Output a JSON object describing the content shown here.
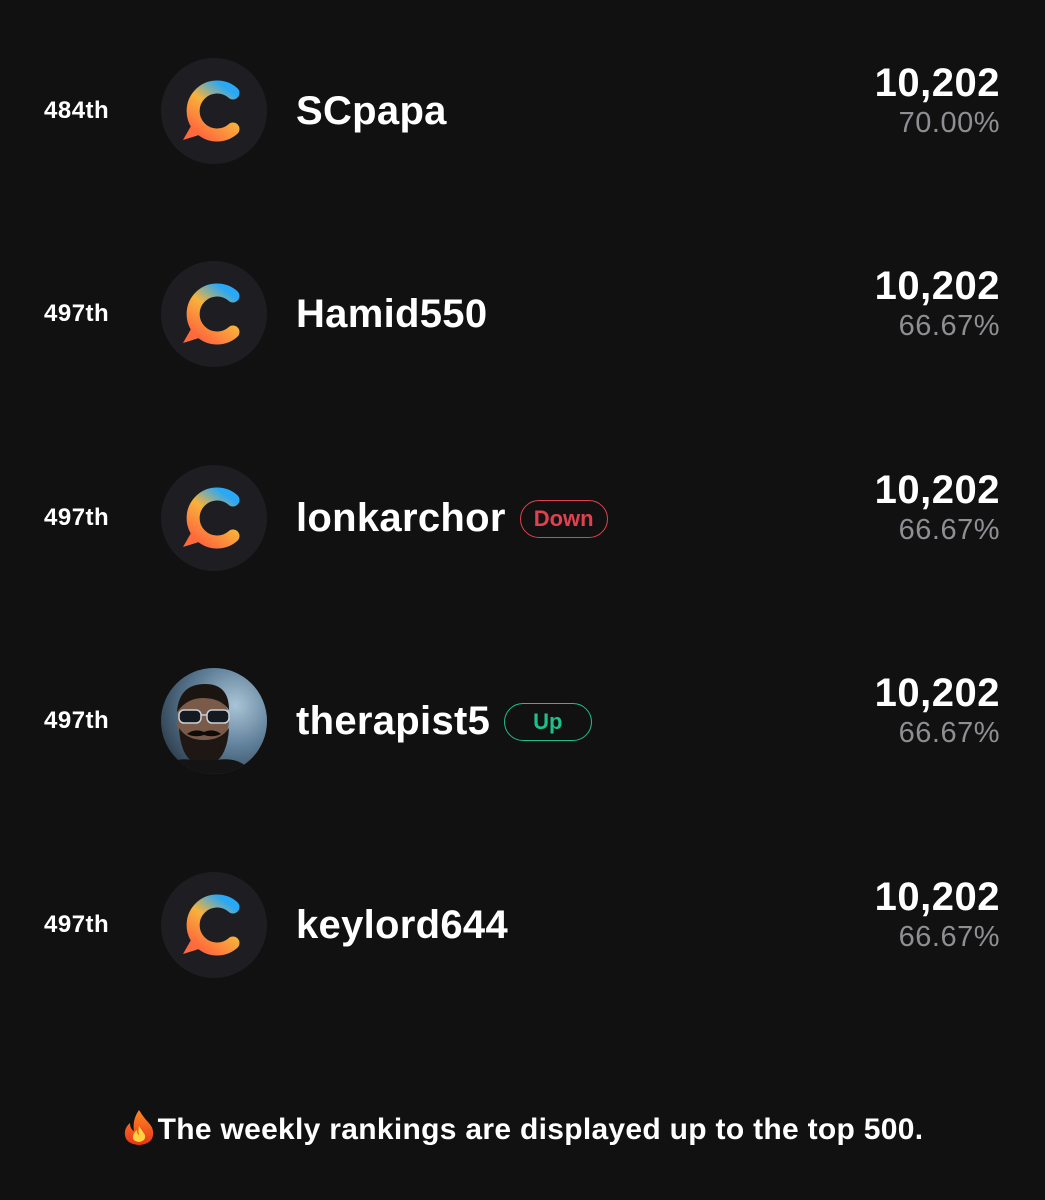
{
  "leaderboard": {
    "rows": [
      {
        "rank": "484th",
        "name": "SCpapa",
        "badge": "",
        "score": "10,202",
        "percent": "70.00%",
        "avatar": "brand-logo"
      },
      {
        "rank": "497th",
        "name": "Hamid550",
        "badge": "",
        "score": "10,202",
        "percent": "66.67%",
        "avatar": "brand-logo"
      },
      {
        "rank": "497th",
        "name": "lonkarchor",
        "badge": "Down",
        "score": "10,202",
        "percent": "66.67%",
        "avatar": "brand-logo"
      },
      {
        "rank": "497th",
        "name": "therapist5",
        "badge": "Up",
        "score": "10,202",
        "percent": "66.67%",
        "avatar": "user-photo"
      },
      {
        "rank": "497th",
        "name": "keylord644",
        "badge": "",
        "score": "10,202",
        "percent": "66.67%",
        "avatar": "brand-logo"
      }
    ]
  },
  "footer": {
    "icon": "fire-icon",
    "text": "The weekly rankings are displayed up to the top 500."
  },
  "colors": {
    "background": "#111112",
    "down": "#e0404f",
    "up": "#1fbf8a",
    "muted": "#8e8e93"
  }
}
